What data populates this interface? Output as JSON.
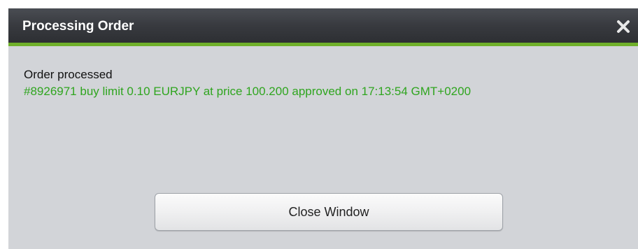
{
  "dialog": {
    "title": "Processing Order",
    "close_icon": "close-icon",
    "heading": "Order processed",
    "message": "#8926971 buy limit 0.10 EURJPY at price 100.200 approved on 17:13:54 GMT+0200",
    "close_button_label": "Close Window"
  },
  "colors": {
    "titlebar": "#383a3f",
    "accent_line": "#6fb02a",
    "body_background": "#d2d4d8",
    "success_text": "#2fa51f"
  }
}
